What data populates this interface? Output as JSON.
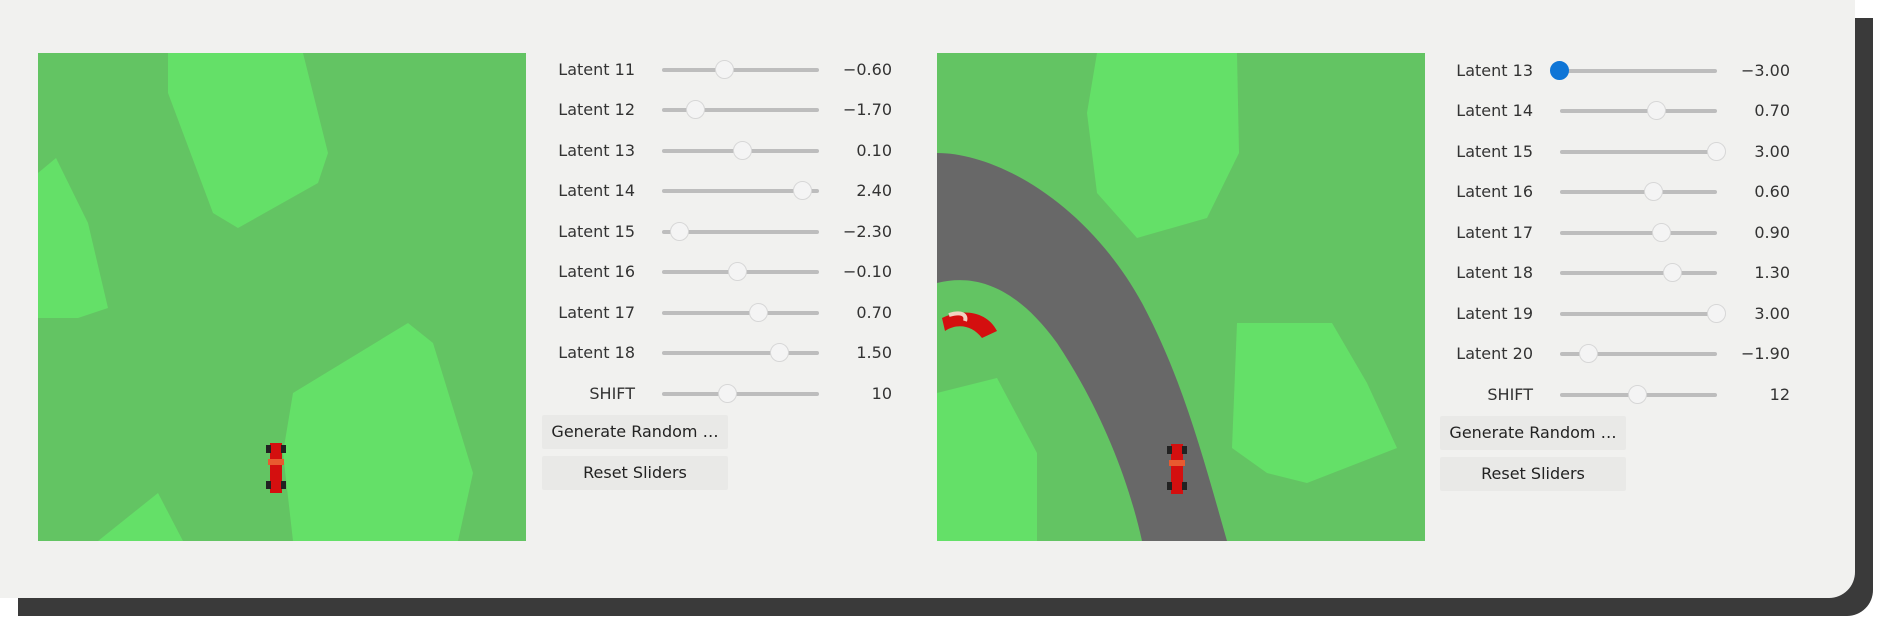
{
  "panels": [
    {
      "sliders": [
        {
          "label": "Latent 11",
          "value": "−0.60",
          "fraction": 0.4
        },
        {
          "label": "Latent 12",
          "value": "−1.70",
          "fraction": 0.217
        },
        {
          "label": "Latent 13",
          "value": "0.10",
          "fraction": 0.517
        },
        {
          "label": "Latent 14",
          "value": "2.40",
          "fraction": 0.9
        },
        {
          "label": "Latent 15",
          "value": "−2.30",
          "fraction": 0.117
        },
        {
          "label": "Latent 16",
          "value": "−0.10",
          "fraction": 0.483
        },
        {
          "label": "Latent 17",
          "value": "0.70",
          "fraction": 0.617
        },
        {
          "label": "Latent 18",
          "value": "1.50",
          "fraction": 0.75
        },
        {
          "label": "SHIFT",
          "value": "10",
          "fraction": 0.42
        }
      ],
      "buttons": {
        "generate": "Generate Random …",
        "reset": "Reset Sliders"
      }
    },
    {
      "sliders": [
        {
          "label": "Latent 13",
          "value": "−3.00",
          "fraction": 0.0,
          "active": true
        },
        {
          "label": "Latent 14",
          "value": "0.70",
          "fraction": 0.617
        },
        {
          "label": "Latent 15",
          "value": "3.00",
          "fraction": 1.0
        },
        {
          "label": "Latent 16",
          "value": "0.60",
          "fraction": 0.6
        },
        {
          "label": "Latent 17",
          "value": "0.90",
          "fraction": 0.65
        },
        {
          "label": "Latent 18",
          "value": "1.30",
          "fraction": 0.717
        },
        {
          "label": "Latent 19",
          "value": "3.00",
          "fraction": 1.0
        },
        {
          "label": "Latent 20",
          "value": "−1.90",
          "fraction": 0.183
        },
        {
          "label": "SHIFT",
          "value": "12",
          "fraction": 0.5
        }
      ],
      "buttons": {
        "generate": "Generate Random …",
        "reset": "Reset Sliders"
      }
    }
  ],
  "colors": {
    "grass": "#63c463",
    "grass_light": "#64e068",
    "road": "#686868",
    "car": "#d40f0f",
    "slider_active": "#0f75d6"
  }
}
